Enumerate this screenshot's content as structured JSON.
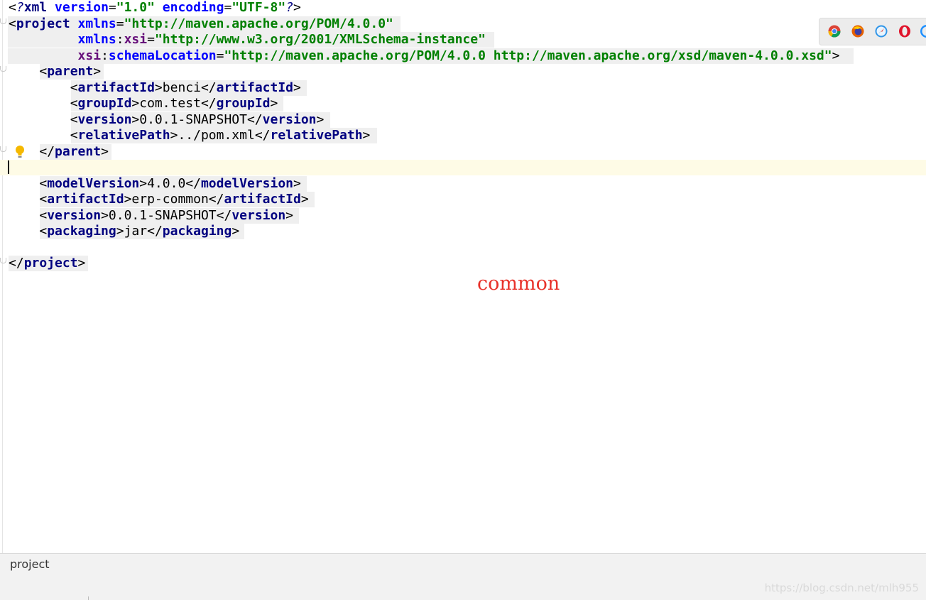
{
  "editor": {
    "lines": [
      {
        "parts": [
          {
            "c": "br",
            "t": "<"
          },
          {
            "c": "pi",
            "t": "?"
          },
          {
            "c": "tag",
            "t": "xml"
          },
          {
            "c": "txt",
            "t": " "
          },
          {
            "c": "attr",
            "t": "version"
          },
          {
            "c": "br",
            "t": "="
          },
          {
            "c": "val",
            "t": "\"1.0\""
          },
          {
            "c": "txt",
            "t": " "
          },
          {
            "c": "attr",
            "t": "encoding"
          },
          {
            "c": "br",
            "t": "="
          },
          {
            "c": "val",
            "t": "\"UTF-8\""
          },
          {
            "c": "pi",
            "t": "?"
          },
          {
            "c": "br",
            "t": ">"
          }
        ]
      },
      {
        "parts": [
          {
            "c": "br",
            "t": "<"
          },
          {
            "c": "tag",
            "t": "project"
          },
          {
            "c": "txt",
            "t": " "
          },
          {
            "c": "attr",
            "t": "xmlns"
          },
          {
            "c": "br",
            "t": "="
          },
          {
            "c": "val",
            "t": "\"http://maven.apache.org/POM/4.0.0\""
          }
        ]
      },
      {
        "parts": [
          {
            "c": "txt",
            "t": "         "
          },
          {
            "c": "attr",
            "t": "xmlns"
          },
          {
            "c": "br",
            "t": ":"
          },
          {
            "c": "ns",
            "t": "xsi"
          },
          {
            "c": "br",
            "t": "="
          },
          {
            "c": "val",
            "t": "\"http://www.w3.org/2001/XMLSchema-instance\""
          }
        ]
      },
      {
        "parts": [
          {
            "c": "txt",
            "t": "         "
          },
          {
            "c": "ns",
            "t": "xsi"
          },
          {
            "c": "br",
            "t": ":"
          },
          {
            "c": "attr",
            "t": "schemaLocation"
          },
          {
            "c": "br",
            "t": "="
          },
          {
            "c": "val",
            "t": "\"http://maven.apache.org/POM/4.0.0 http://maven.apache.org/xsd/maven-4.0.0.xsd\""
          },
          {
            "c": "br",
            "t": ">"
          }
        ]
      },
      {
        "parts": [
          {
            "c": "txt",
            "t": "    "
          },
          {
            "c": "br",
            "t": "<"
          },
          {
            "c": "tag",
            "t": "parent"
          },
          {
            "c": "br",
            "t": ">"
          }
        ]
      },
      {
        "parts": [
          {
            "c": "txt",
            "t": "        "
          },
          {
            "c": "br",
            "t": "<"
          },
          {
            "c": "tag",
            "t": "artifactId"
          },
          {
            "c": "br",
            "t": ">"
          },
          {
            "c": "txt",
            "t": "benci"
          },
          {
            "c": "br",
            "t": "</"
          },
          {
            "c": "tag",
            "t": "artifactId"
          },
          {
            "c": "br",
            "t": ">"
          }
        ]
      },
      {
        "parts": [
          {
            "c": "txt",
            "t": "        "
          },
          {
            "c": "br",
            "t": "<"
          },
          {
            "c": "tag",
            "t": "groupId"
          },
          {
            "c": "br",
            "t": ">"
          },
          {
            "c": "txt",
            "t": "com.test"
          },
          {
            "c": "br",
            "t": "</"
          },
          {
            "c": "tag",
            "t": "groupId"
          },
          {
            "c": "br",
            "t": ">"
          }
        ]
      },
      {
        "parts": [
          {
            "c": "txt",
            "t": "        "
          },
          {
            "c": "br",
            "t": "<"
          },
          {
            "c": "tag",
            "t": "version"
          },
          {
            "c": "br",
            "t": ">"
          },
          {
            "c": "txt",
            "t": "0.0.1-SNAPSHOT"
          },
          {
            "c": "br",
            "t": "</"
          },
          {
            "c": "tag",
            "t": "version"
          },
          {
            "c": "br",
            "t": ">"
          }
        ]
      },
      {
        "parts": [
          {
            "c": "txt",
            "t": "        "
          },
          {
            "c": "br",
            "t": "<"
          },
          {
            "c": "tag",
            "t": "relativePath"
          },
          {
            "c": "br",
            "t": ">"
          },
          {
            "c": "txt",
            "t": "../pom.xml"
          },
          {
            "c": "br",
            "t": "</"
          },
          {
            "c": "tag",
            "t": "relativePath"
          },
          {
            "c": "br",
            "t": ">"
          }
        ]
      },
      {
        "parts": [
          {
            "c": "txt",
            "t": "    "
          },
          {
            "c": "br",
            "t": "</"
          },
          {
            "c": "tag",
            "t": "parent"
          },
          {
            "c": "br",
            "t": ">"
          }
        ]
      },
      {
        "parts": []
      },
      {
        "parts": [
          {
            "c": "txt",
            "t": "    "
          },
          {
            "c": "br",
            "t": "<"
          },
          {
            "c": "tag",
            "t": "modelVersion"
          },
          {
            "c": "br",
            "t": ">"
          },
          {
            "c": "txt",
            "t": "4.0.0"
          },
          {
            "c": "br",
            "t": "</"
          },
          {
            "c": "tag",
            "t": "modelVersion"
          },
          {
            "c": "br",
            "t": ">"
          }
        ]
      },
      {
        "parts": [
          {
            "c": "txt",
            "t": "    "
          },
          {
            "c": "br",
            "t": "<"
          },
          {
            "c": "tag",
            "t": "artifactId"
          },
          {
            "c": "br",
            "t": ">"
          },
          {
            "c": "txt",
            "t": "erp-common"
          },
          {
            "c": "br",
            "t": "</"
          },
          {
            "c": "tag",
            "t": "artifactId"
          },
          {
            "c": "br",
            "t": ">"
          }
        ]
      },
      {
        "parts": [
          {
            "c": "txt",
            "t": "    "
          },
          {
            "c": "br",
            "t": "<"
          },
          {
            "c": "tag",
            "t": "version"
          },
          {
            "c": "br",
            "t": ">"
          },
          {
            "c": "txt",
            "t": "0.0.1-SNAPSHOT"
          },
          {
            "c": "br",
            "t": "</"
          },
          {
            "c": "tag",
            "t": "version"
          },
          {
            "c": "br",
            "t": ">"
          }
        ]
      },
      {
        "parts": [
          {
            "c": "txt",
            "t": "    "
          },
          {
            "c": "br",
            "t": "<"
          },
          {
            "c": "tag",
            "t": "packaging"
          },
          {
            "c": "br",
            "t": ">"
          },
          {
            "c": "txt",
            "t": "jar"
          },
          {
            "c": "br",
            "t": "</"
          },
          {
            "c": "tag",
            "t": "packaging"
          },
          {
            "c": "br",
            "t": ">"
          }
        ]
      },
      {
        "parts": []
      },
      {
        "parts": [
          {
            "c": "br",
            "t": "</"
          },
          {
            "c": "tag",
            "t": "project"
          },
          {
            "c": "br",
            "t": ">"
          }
        ]
      }
    ],
    "current_line": 10,
    "hint_icon": "lightbulb-icon"
  },
  "browser_icons": [
    "chrome-icon",
    "firefox-icon",
    "safari-icon",
    "opera-icon",
    "ie-icon"
  ],
  "annotation": "common",
  "breadcrumb": "project",
  "watermark": "https://blog.csdn.net/mlh955"
}
